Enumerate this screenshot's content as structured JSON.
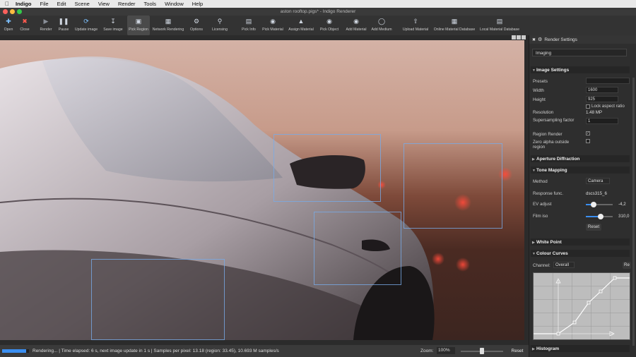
{
  "menubar": {
    "app": "Indigo",
    "items": [
      "File",
      "Edit",
      "Scene",
      "View",
      "Render",
      "Tools",
      "Window",
      "Help"
    ]
  },
  "window": {
    "title": "aston rooftop.pigs* - Indigo Renderer"
  },
  "toolbar": {
    "buttons": [
      {
        "label": "Open",
        "icon": "open-icon"
      },
      {
        "label": "Close",
        "icon": "close-icon"
      },
      {
        "label": "Render",
        "icon": "render-icon"
      },
      {
        "label": "Pause",
        "icon": "pause-icon"
      },
      {
        "label": "Update image",
        "icon": "refresh-icon"
      },
      {
        "label": "Save image",
        "icon": "save-icon"
      },
      {
        "label": "Pick Region",
        "icon": "region-icon"
      },
      {
        "label": "Network Rendering",
        "icon": "network-icon"
      },
      {
        "label": "Options",
        "icon": "gear-icon"
      },
      {
        "label": "Licensing",
        "icon": "key-icon"
      },
      {
        "label": "Pick Info",
        "icon": "info-icon"
      },
      {
        "label": "Pick Material",
        "icon": "material-icon"
      },
      {
        "label": "Assign Material",
        "icon": "assign-icon"
      },
      {
        "label": "Pick Object",
        "icon": "object-icon"
      },
      {
        "label": "Add Material",
        "icon": "add-material-icon"
      },
      {
        "label": "Add Medium",
        "icon": "medium-icon"
      },
      {
        "label": "Upload Material",
        "icon": "upload-icon"
      },
      {
        "label": "Online Material Database",
        "icon": "database-icon"
      },
      {
        "label": "Local Material Database",
        "icon": "local-db-icon"
      }
    ]
  },
  "status": {
    "text": "Rendering... | Time elapsed: 6 s, next image update in 1 s | Samples per pixel: 13.18 (region: 33.45), 10.693 M samples/s",
    "progress": 0.9,
    "zoom_label": "Zoom:",
    "zoom_value": "100%",
    "zoom_slider": 0.5,
    "reset_label": "Reset"
  },
  "panel": {
    "title": "Render Settings",
    "mode": "Imaging",
    "image_settings": {
      "header": "Image Settings",
      "presets_label": "Presets",
      "width_label": "Width",
      "width_value": "1600",
      "height_label": "Height",
      "height_value": "925",
      "lock_label": "Lock aspect ratio",
      "lock_checked": false,
      "resolution_label": "Resolution",
      "resolution_value": "1.48 MP",
      "supersampling_label": "Supersampling factor",
      "supersampling_value": "1",
      "region_render_label": "Region Render",
      "region_render_checked": true,
      "zero_alpha_label": "Zero alpha outside region",
      "zero_alpha_checked": false
    },
    "aperture_header": "Aperture Diffraction",
    "tone_mapping": {
      "header": "Tone Mapping",
      "method_label": "Method",
      "method_value": "Camera",
      "response_label": "Response func.",
      "response_value": "dscs315_6",
      "ev_label": "EV adjust",
      "ev_value": "-4,2",
      "ev_slider": 0.3,
      "film_label": "Film iso",
      "film_value": "310,0",
      "film_slider": 0.55,
      "reset_label": "Reset"
    },
    "white_point_header": "White Point",
    "colour_curves": {
      "header": "Colour Curves",
      "channel_label": "Channel:",
      "channel_value": "Overall",
      "reset_label": "Re"
    },
    "histogram_header": "Histogram"
  }
}
